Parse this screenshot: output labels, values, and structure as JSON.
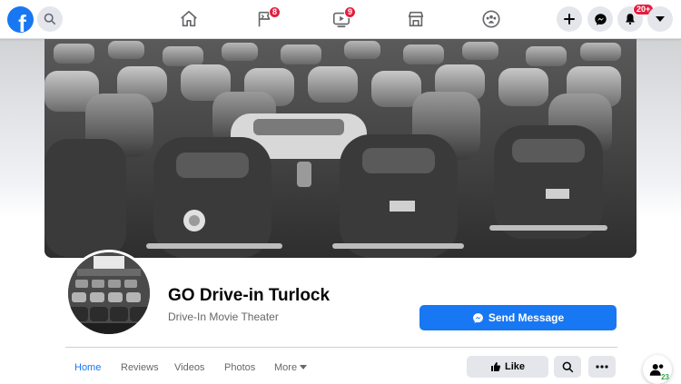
{
  "topbar": {
    "logo_letter": "f",
    "badges": {
      "pages": "8",
      "watch": "9",
      "notifications": "20+"
    }
  },
  "page": {
    "name": "GO Drive-in Turlock",
    "category": "Drive-In Movie Theater"
  },
  "actions": {
    "send_message": "Send Message",
    "like": "Like"
  },
  "tabs": [
    {
      "label": "Home"
    },
    {
      "label": "Reviews"
    },
    {
      "label": "Videos"
    },
    {
      "label": "Photos"
    },
    {
      "label": "More"
    }
  ],
  "friends_online": "23",
  "colors": {
    "brand": "#1877f2",
    "badge": "#e41e3f",
    "online": "#31a24c"
  }
}
